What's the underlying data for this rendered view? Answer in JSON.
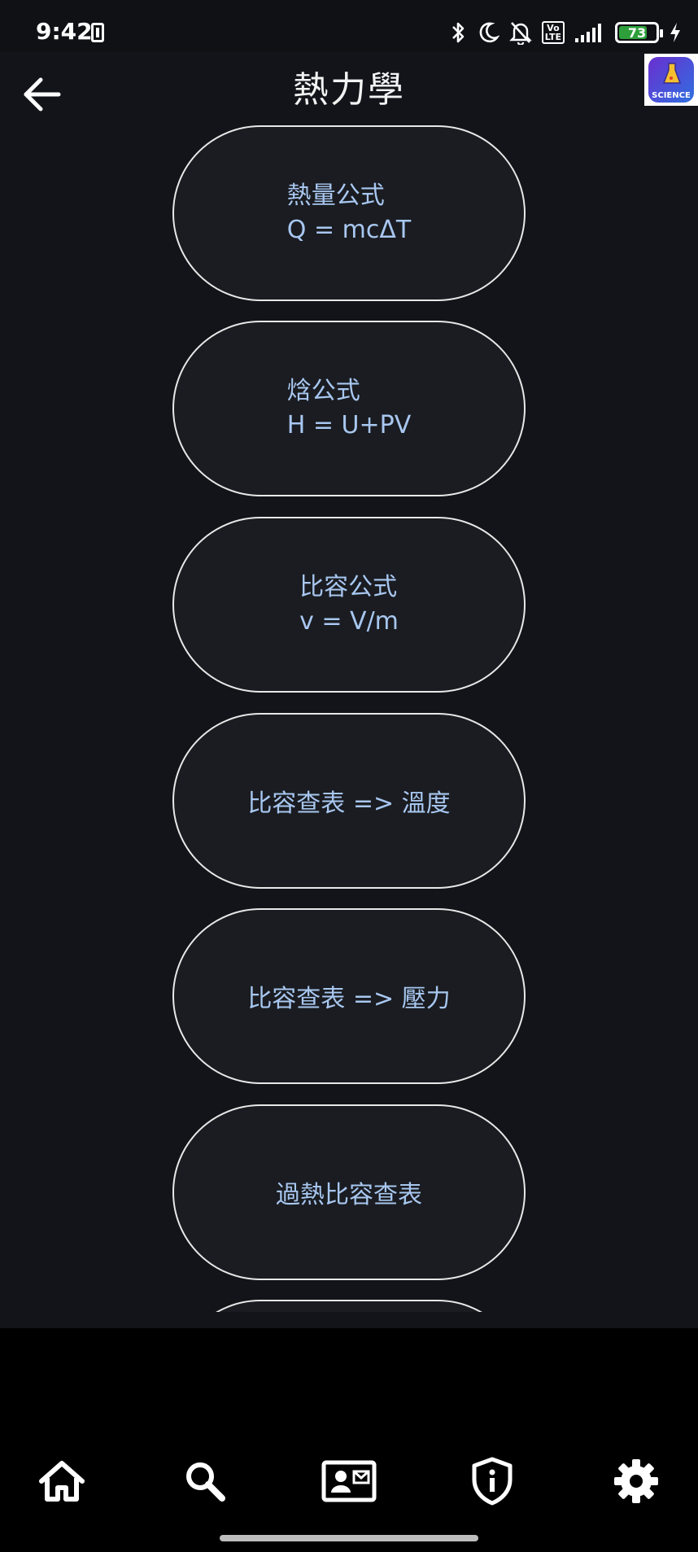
{
  "status": {
    "time": "9:42",
    "volte_top": "Vo",
    "volte_bottom": "LTE",
    "battery": "73"
  },
  "header": {
    "title": "熱力學"
  },
  "logo": {
    "text": "SCIENCE"
  },
  "items": [
    {
      "line1": "熱量公式",
      "line2": "Q = mcΔT"
    },
    {
      "line1": "焓公式",
      "line2": "H = U+PV"
    },
    {
      "line1": "比容公式",
      "line2": "v = V/m"
    },
    {
      "label": "比容查表 => 溫度"
    },
    {
      "label": "比容查表 => 壓力"
    },
    {
      "label": "過熱比容查表"
    }
  ],
  "nav": [
    "home-icon",
    "search-icon",
    "contact-card-icon",
    "shield-info-icon",
    "gear-icon"
  ],
  "colors": {
    "accent_text": "#a8c7f0",
    "background": "#121419",
    "pill_border": "#e8e8e8"
  }
}
